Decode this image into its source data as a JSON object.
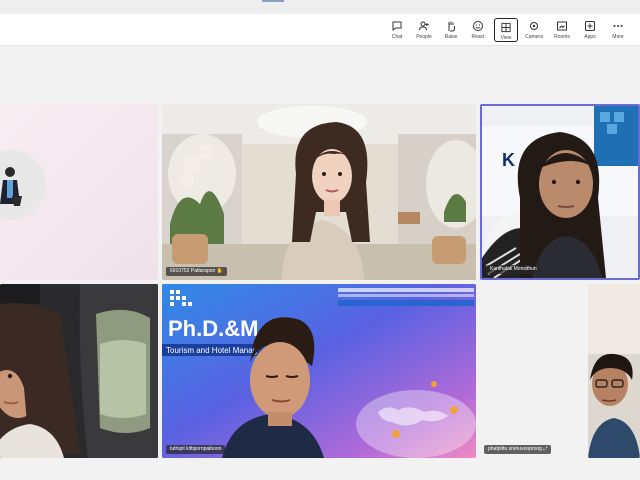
{
  "toolbar": {
    "buttons": [
      {
        "label": "Chat",
        "icon": "chat-icon"
      },
      {
        "label": "People",
        "icon": "people-icon"
      },
      {
        "label": "Raise",
        "icon": "raise-hand-icon"
      },
      {
        "label": "React",
        "icon": "react-icon"
      },
      {
        "label": "View",
        "icon": "view-icon"
      },
      {
        "label": "Camera",
        "icon": "camera-icon"
      },
      {
        "label": "Rooms",
        "icon": "rooms-icon"
      },
      {
        "label": "Apps",
        "icon": "apps-icon"
      },
      {
        "label": "More",
        "icon": "more-icon"
      }
    ]
  },
  "participants": {
    "p2": {
      "name": "6910752 Pattarapon"
    },
    "p3": {
      "name": "Kanthalak Monsithun"
    },
    "p5": {
      "name": "tuthipit kittipornpaiboon"
    },
    "p6": {
      "name": "phatpittu srenuvonprong"
    }
  },
  "slide": {
    "logo_text": "Ph.D.&M.",
    "subtitle": "Tourism and Hotel Manag"
  },
  "background_text": {
    "p3_letters": "K"
  },
  "colors": {
    "active_speaker_border": "#6b6bd6",
    "toolbar_bg": "#ffffff",
    "stage_bg": "#f2f2f2"
  }
}
